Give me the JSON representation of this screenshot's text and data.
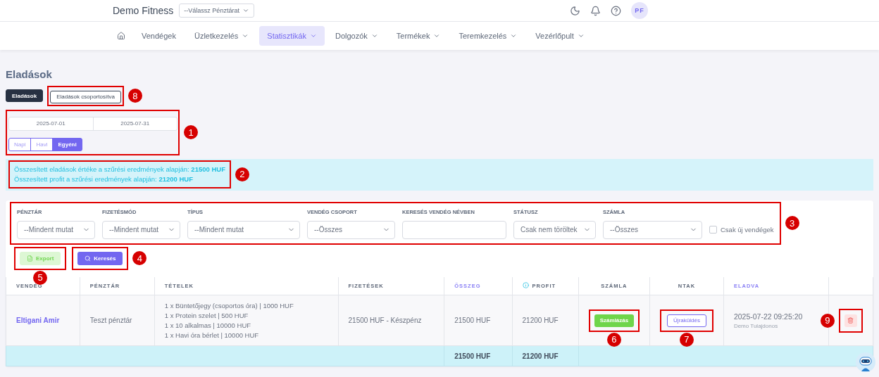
{
  "header": {
    "brand": "Demo Fitness",
    "register_select": "--Válassz Pénztárat",
    "avatar": "PF"
  },
  "nav": [
    {
      "label": "Vendégek",
      "selected": false,
      "dropdown": false
    },
    {
      "label": "Üzletkezelés",
      "selected": false,
      "dropdown": true
    },
    {
      "label": "Statisztikák",
      "selected": true,
      "dropdown": true
    },
    {
      "label": "Dolgozók",
      "selected": false,
      "dropdown": true
    },
    {
      "label": "Termékek",
      "selected": false,
      "dropdown": true
    },
    {
      "label": "Teremkezelés",
      "selected": false,
      "dropdown": true
    },
    {
      "label": "Vezérlőpult",
      "selected": false,
      "dropdown": true
    }
  ],
  "page_title": "Eladások",
  "view_tabs": [
    {
      "label": "Eladások",
      "selected": true
    },
    {
      "label": "Eladások csoportosítva",
      "selected": false,
      "callout": "8"
    }
  ],
  "date_filter": {
    "callout": "1",
    "from": "2025-07-01",
    "to": "2025-07-31",
    "periods": [
      {
        "label": "Napi",
        "selected": false
      },
      {
        "label": "Havi",
        "selected": false
      },
      {
        "label": "Egyéni",
        "selected": true
      }
    ]
  },
  "summary": {
    "callout": "2",
    "lines": [
      "Összesített eladások értéke a szűrési eredmények alapján: **21500 HUF**",
      "Összesített profit a szűrési eredmények alapján: **21200 HUF**"
    ]
  },
  "filters": {
    "callout": "3",
    "fields": [
      {
        "label": "PÉNZTÁR",
        "kind": "select",
        "value": "--Mindent mutat"
      },
      {
        "label": "FIZETÉSMÓD",
        "kind": "select",
        "value": "--Mindent mutat"
      },
      {
        "label": "TÍPUS",
        "kind": "select",
        "value": "--Mindent mutat"
      },
      {
        "label": "VENDÉG CSOPORT",
        "kind": "select",
        "value": "--Összes"
      },
      {
        "label": "KERESÉS VENDÉG NÉVBEN",
        "kind": "text"
      },
      {
        "label": "STÁTUSZ",
        "kind": "select",
        "value": "Csak nem töröltek"
      },
      {
        "label": "SZÁMLA",
        "kind": "select",
        "value": "--Összes"
      }
    ],
    "new_guests": {
      "label": "Csak új vendégek",
      "checked": false
    }
  },
  "actions": [
    {
      "label": "Export",
      "kind": "export",
      "callout": "5"
    },
    {
      "label": "Keresés",
      "kind": "search",
      "callout": "4"
    }
  ],
  "table": {
    "columns": [
      {
        "label": "VENDÉG",
        "sortable": false
      },
      {
        "label": "PÉNZTÁR",
        "sortable": false
      },
      {
        "label": "TÉTELEK",
        "sortable": false
      },
      {
        "label": "FIZETÉSEK",
        "sortable": false
      },
      {
        "label": "ÖSSZEG",
        "sortable": true
      },
      {
        "label": "PROFIT",
        "sortable": false,
        "info": true
      },
      {
        "label": "SZÁMLA",
        "sortable": false
      },
      {
        "label": "NTAK",
        "sortable": false
      },
      {
        "label": "ELADVA",
        "sortable": true
      }
    ],
    "rows": [
      {
        "guest": "Eltigani Amir",
        "register": "Teszt pénztár",
        "items": [
          "1 x Büntetőjegy (csoportos óra) | 1000 HUF",
          "1 x Protein szelet | 500 HUF",
          "1 x 10 alkalmas | 10000 HUF",
          "1 x Havi óra bérlet | 10000 HUF"
        ],
        "payment": "21500 HUF - Készpénz",
        "amount": "21500 HUF",
        "profit": "21200 HUF",
        "invoice_button": {
          "label": "Számlázás",
          "callout": "6"
        },
        "ntak_button": {
          "label": "Újraküldés",
          "callout": "7"
        },
        "sold_at": "2025-07-22 09:25:20",
        "sold_by": "Demo Tulajdonos",
        "delete": {
          "callout": "9"
        }
      }
    ],
    "totals": {
      "amount": "21500 HUF",
      "profit": "21200 HUF"
    }
  }
}
